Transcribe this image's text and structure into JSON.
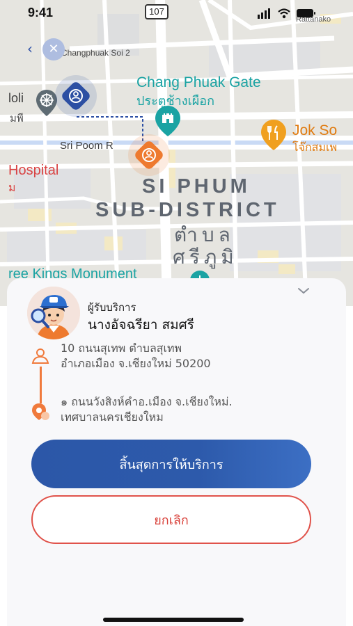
{
  "status_bar": {
    "time": "9:41",
    "route_shield": "107",
    "icons": [
      "signal-icon",
      "wifi-icon",
      "battery-icon"
    ]
  },
  "map": {
    "labels": {
      "changphuak_soi": "Changphuak Soi 2",
      "gate_en": "Chang Phuak Gate",
      "gate_th": "ประตูช้างเผือก",
      "jok_en": "Jok So",
      "jok_th": "โจ๊กสมเพ",
      "sri_poom": "Sri Poom R",
      "hospital_en": "Hospital",
      "hospital_th": "ม",
      "holi": "loli",
      "holi_th": "มพี",
      "district_line1": "SI PHUM",
      "district_line2": "SUB-DISTRICT",
      "district_th1": "ตำบล",
      "district_th2": "ศรีภูมิ",
      "monument": "ree Kings Monument",
      "rattanakosin": "Rattanako"
    },
    "colors": {
      "background": "#e6e5e0",
      "road": "#ffffff",
      "water": "#c9daf5",
      "block": "#f3e9c4",
      "driver_marker": "#2c4fa3",
      "customer_marker": "#ee7a2f",
      "poi_teal": "#1aa3a3",
      "poi_orange": "#f0a020"
    }
  },
  "sheet": {
    "receiver_label": "ผู้รับบริการ",
    "receiver_name": "นางอัจฉรียา สมศรี",
    "address_from_line1": "10 ถนนสุเทพ ตำบลสุเทพ",
    "address_from_line2": "อำเภอเมือง จ.เชียงใหม่ 50200",
    "address_to_line1": "๑ ถนนวังสิงห์คำอ.เมือง จ.เชียงใหม่.",
    "address_to_line2": "เทศบาลนครเชียงใหม",
    "finish_button": "สิ้นสุดการให้บริการ",
    "cancel_button": "ยกเลิก",
    "colors": {
      "finish_button": "#2c57a8",
      "cancel_border": "#e0524a",
      "route_line": "#f07a3c"
    }
  }
}
